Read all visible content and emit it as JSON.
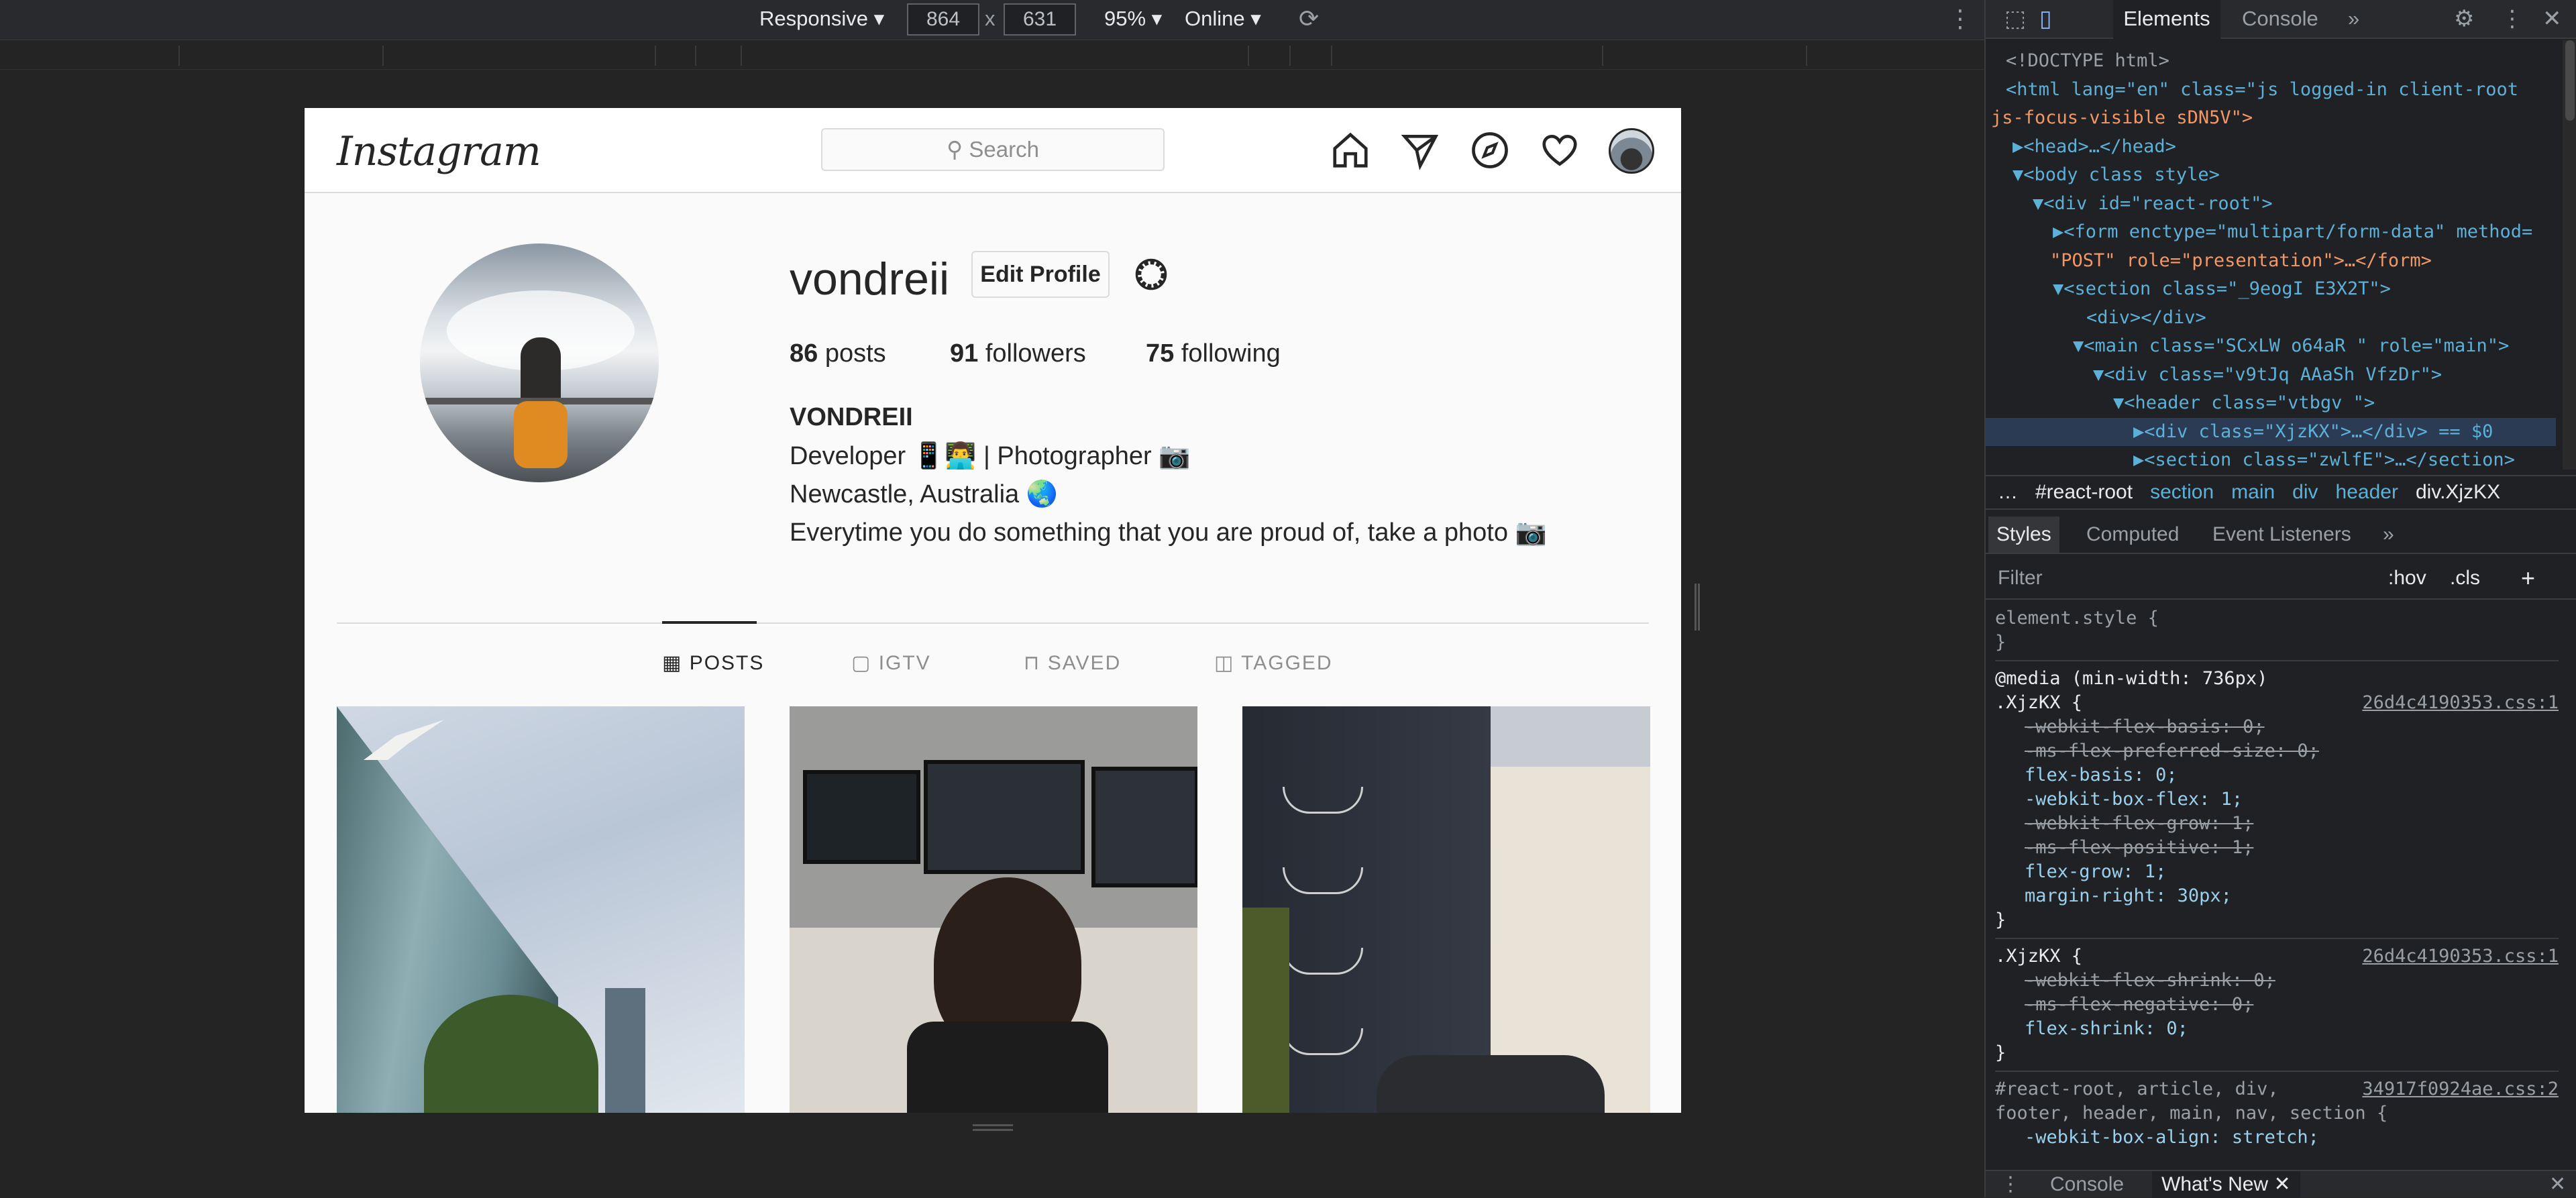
{
  "device_toolbar": {
    "device": "Responsive",
    "width": "864",
    "times": "x",
    "height": "631",
    "zoom": "95%",
    "throttle": "Online"
  },
  "instagram": {
    "logo": "Instagram",
    "search_placeholder": "Search",
    "profile": {
      "username": "vondreii",
      "edit_label": "Edit Profile",
      "posts_count": "86",
      "posts_label": "posts",
      "followers_count": "91",
      "followers_label": "followers",
      "following_count": "75",
      "following_label": "following",
      "display_name": "VONDREII",
      "bio_line1": "Developer 📱👨‍💻 | Photographer 📷",
      "bio_line2": "Newcastle, Australia 🌏",
      "bio_line3": "Everytime you do something that you are proud of, take a photo 📷"
    },
    "tabs": [
      "POSTS",
      "IGTV",
      "SAVED",
      "TAGGED"
    ],
    "active_tab": "POSTS"
  },
  "devtools": {
    "tabs": [
      "Elements",
      "Console"
    ],
    "active_tab": "Elements",
    "dom_lines": [
      "<!DOCTYPE html>",
      "<html lang=\"en\" class=\"js logged-in client-root",
      "js-focus-visible sDN5V\">",
      "▶<head>…</head>",
      "▼<body class style>",
      "▼<div id=\"react-root\">",
      "▶<form enctype=\"multipart/form-data\" method=",
      "\"POST\" role=\"presentation\">…</form>",
      "▼<section class=\"_9eogI E3X2T\">",
      "<div></div>",
      "▼<main class=\"SCxLW  o64aR \" role=\"main\">",
      "▼<div class=\"v9tJq AAaSh VfzDr\">",
      "▼<header class=\"vtbgv \">",
      "▶<div class=\"XjzKX\">…</div> == $0",
      "▶<section class=\"zwlfE\">…</section>"
    ],
    "breadcrumbs": [
      "…",
      "#react-root",
      "section",
      "main",
      "div",
      "header",
      "div.XjzKX"
    ],
    "styles_tabs": [
      "Styles",
      "Computed",
      "Event Listeners"
    ],
    "filter_placeholder": "Filter",
    "hov": ":hov",
    "cls": ".cls",
    "css_lines": {
      "element_style": "element.style {",
      "close": "}",
      "media": "@media (min-width: 736px)",
      "sel1": ".XjzKX {",
      "src1": "26d4c4190353.css:1",
      "r1": "-webkit-flex-basis: 0;",
      "r2": "-ms-flex-preferred-size: 0;",
      "r3": "flex-basis: 0;",
      "r4": "-webkit-box-flex: 1;",
      "r5": "-webkit-flex-grow: 1;",
      "r6": "-ms-flex-positive: 1;",
      "r7": "flex-grow: 1;",
      "r8": "margin-right: 30px;",
      "sel2": ".XjzKX {",
      "src2": "26d4c4190353.css:1",
      "r9": "-webkit-flex-shrink: 0;",
      "r10": "-ms-flex-negative: 0;",
      "r11": "flex-shrink: 0;",
      "sel3": "#react-root, article, div,",
      "sel3b": "footer, header, main, nav, section {",
      "src3": "34917f0924ae.css:2",
      "r12": "-webkit-box-align: stretch;"
    },
    "drawer_tabs": [
      "Console",
      "What's New"
    ]
  }
}
